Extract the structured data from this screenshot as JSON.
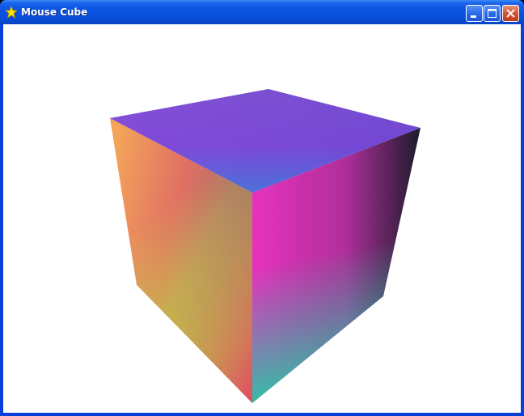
{
  "window": {
    "title": "Mouse Cube",
    "icon": "star-icon",
    "buttons": {
      "minimize": "minimize-icon",
      "maximize": "maximize-icon",
      "close": "close-icon"
    }
  },
  "colors": {
    "titlebar": "#0A4FDB",
    "client_background": "#FFFFFF",
    "top_face": "#7A4FD8",
    "right_face": "#C02FB5",
    "left_face": "#D8706A",
    "bottom_vertex": "#1FC7A8"
  }
}
